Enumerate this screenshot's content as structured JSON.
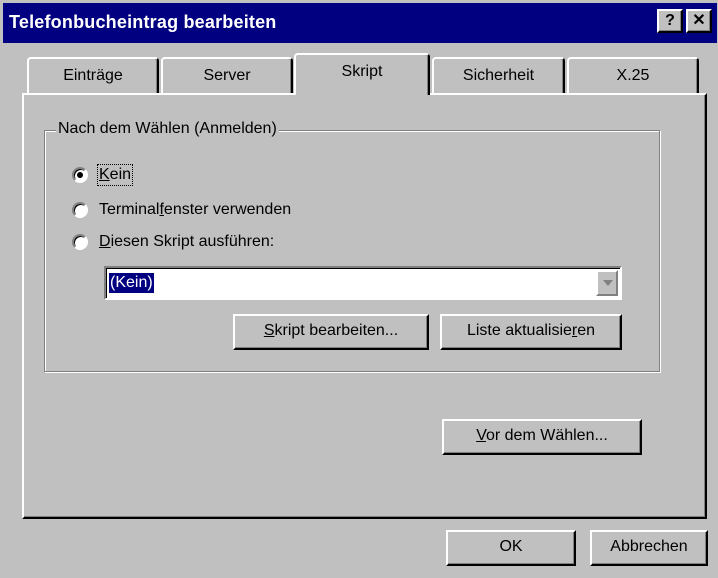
{
  "window": {
    "title": "Telefonbucheintrag bearbeiten",
    "help_glyph": "?",
    "close_glyph": "✕"
  },
  "tabs": [
    {
      "label": "Einträge",
      "active": false
    },
    {
      "label": "Server",
      "active": false
    },
    {
      "label": "Skript",
      "active": true
    },
    {
      "label": "Sicherheit",
      "active": false
    },
    {
      "label": "X.25",
      "active": false
    }
  ],
  "group": {
    "legend": "Nach dem Wählen (Anmelden)",
    "options": [
      {
        "pre": "",
        "ul": "K",
        "post": "ein",
        "selected": true
      },
      {
        "pre": "Terminal",
        "ul": "f",
        "post": "enster verwenden",
        "selected": false
      },
      {
        "pre": "",
        "ul": "D",
        "post": "iesen Skript ausführen:",
        "selected": false
      }
    ],
    "script_select_value": "(Kein)",
    "edit_script_button": {
      "pre": "",
      "ul": "S",
      "post": "kript bearbeiten..."
    },
    "refresh_list_button": {
      "pre": "Liste aktualisie",
      "ul": "r",
      "post": "en"
    }
  },
  "before_dial_button": {
    "pre": "",
    "ul": "V",
    "post": "or dem Wählen..."
  },
  "footer": {
    "ok_label": "OK",
    "cancel_label": "Abbrechen"
  },
  "colors": {
    "titlebar": "#000080",
    "face": "#c0c0c0",
    "selection": "#000080"
  }
}
